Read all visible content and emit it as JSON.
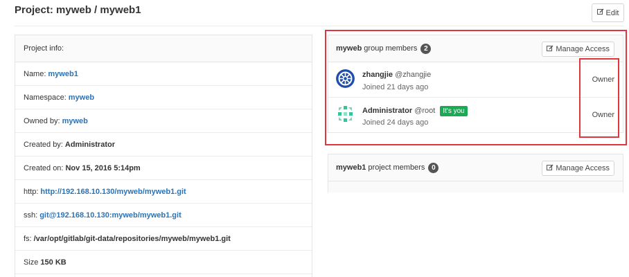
{
  "page": {
    "title": "Project: myweb / myweb1",
    "edit_label": "Edit"
  },
  "project_info": {
    "header": "Project info:",
    "rows": [
      {
        "label": "Name:",
        "value": "myweb1",
        "style": "link"
      },
      {
        "label": "Namespace:",
        "value": "myweb",
        "style": "link"
      },
      {
        "label": "Owned by:",
        "value": "myweb",
        "style": "link"
      },
      {
        "label": "Created by:",
        "value": "Administrator",
        "style": "bold"
      },
      {
        "label": "Created on:",
        "value": "Nov 15, 2016 5:14pm",
        "style": "bold"
      },
      {
        "label": "http:",
        "value": "http://192.168.10.130/myweb/myweb1.git",
        "style": "link"
      },
      {
        "label": "ssh:",
        "value": "git@192.168.10.130:myweb/myweb1.git",
        "style": "link"
      },
      {
        "label": "fs:",
        "value": "/var/opt/gitlab/git-data/repositories/myweb/myweb1.git",
        "style": "bold"
      },
      {
        "label": "Size",
        "value": "150 KB",
        "style": "bold"
      }
    ]
  },
  "group_members": {
    "group_name": "myweb",
    "title_suffix": "group members",
    "count": "2",
    "manage_label": "Manage Access",
    "members": [
      {
        "name": "zhangjie",
        "handle": "@zhangjie",
        "joined": "Joined 21 days ago",
        "role": "Owner",
        "badge": ""
      },
      {
        "name": "Administrator",
        "handle": "@root",
        "joined": "Joined 24 days ago",
        "role": "Owner",
        "badge": "It's you"
      }
    ]
  },
  "project_members": {
    "project_name": "myweb1",
    "title_suffix": "project members",
    "count": "0",
    "manage_label": "Manage Access"
  },
  "colors": {
    "link": "#2a72b5",
    "highlight": "#e0353a",
    "you_badge": "#1aaa55"
  },
  "icons": {
    "edit": "pencil-square-icon"
  }
}
